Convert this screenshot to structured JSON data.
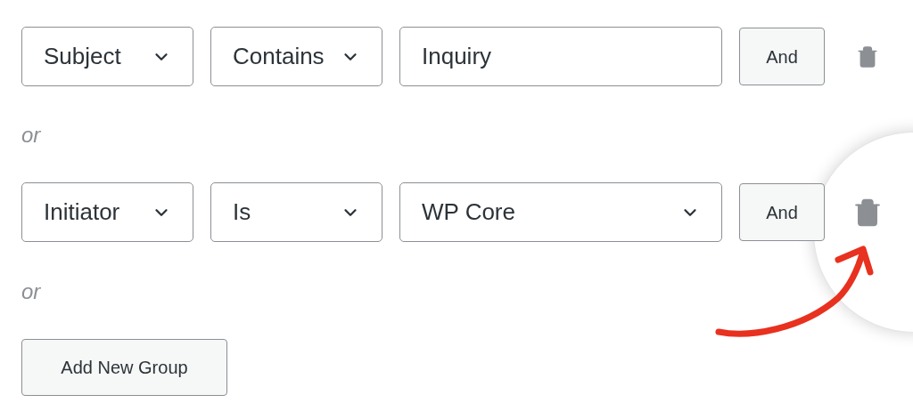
{
  "groups": [
    {
      "fields": [
        {
          "kind": "select",
          "value": "Subject"
        },
        {
          "kind": "select",
          "value": "Contains"
        },
        {
          "kind": "input",
          "value": "Inquiry"
        }
      ],
      "and_label": "And",
      "highlighted": false,
      "separator": "or"
    },
    {
      "fields": [
        {
          "kind": "select",
          "value": "Initiator"
        },
        {
          "kind": "select",
          "value": "Is"
        },
        {
          "kind": "select",
          "value": "WP Core"
        }
      ],
      "and_label": "And",
      "highlighted": true,
      "separator": "or"
    }
  ],
  "add_button": "Add New Group"
}
